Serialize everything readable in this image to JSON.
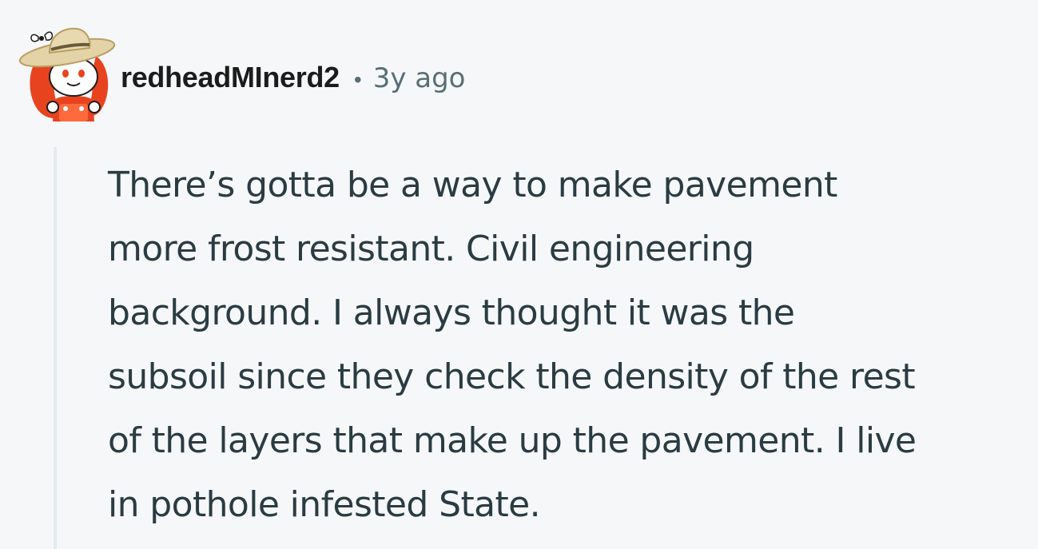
{
  "comment": {
    "author": "redheadMInerd2",
    "separator": "•",
    "timestamp": "3y ago",
    "avatar_icon": "snoo-farmer-avatar-icon",
    "body_lines": [
      "There’s gotta be a way to make pavement",
      "more frost resistant. Civil engineering",
      "background. I always thought it was the",
      "subsoil since they check the density of the rest",
      "of the layers that make up the pavement. I live",
      "in pothole infested State."
    ]
  },
  "colors": {
    "background": "#f6f7f9",
    "username": "#1c1c1c",
    "meta": "#576f76",
    "body": "#2a3c42",
    "thread_line": "#e5ebee",
    "avatar_hair": "#e8431f"
  }
}
